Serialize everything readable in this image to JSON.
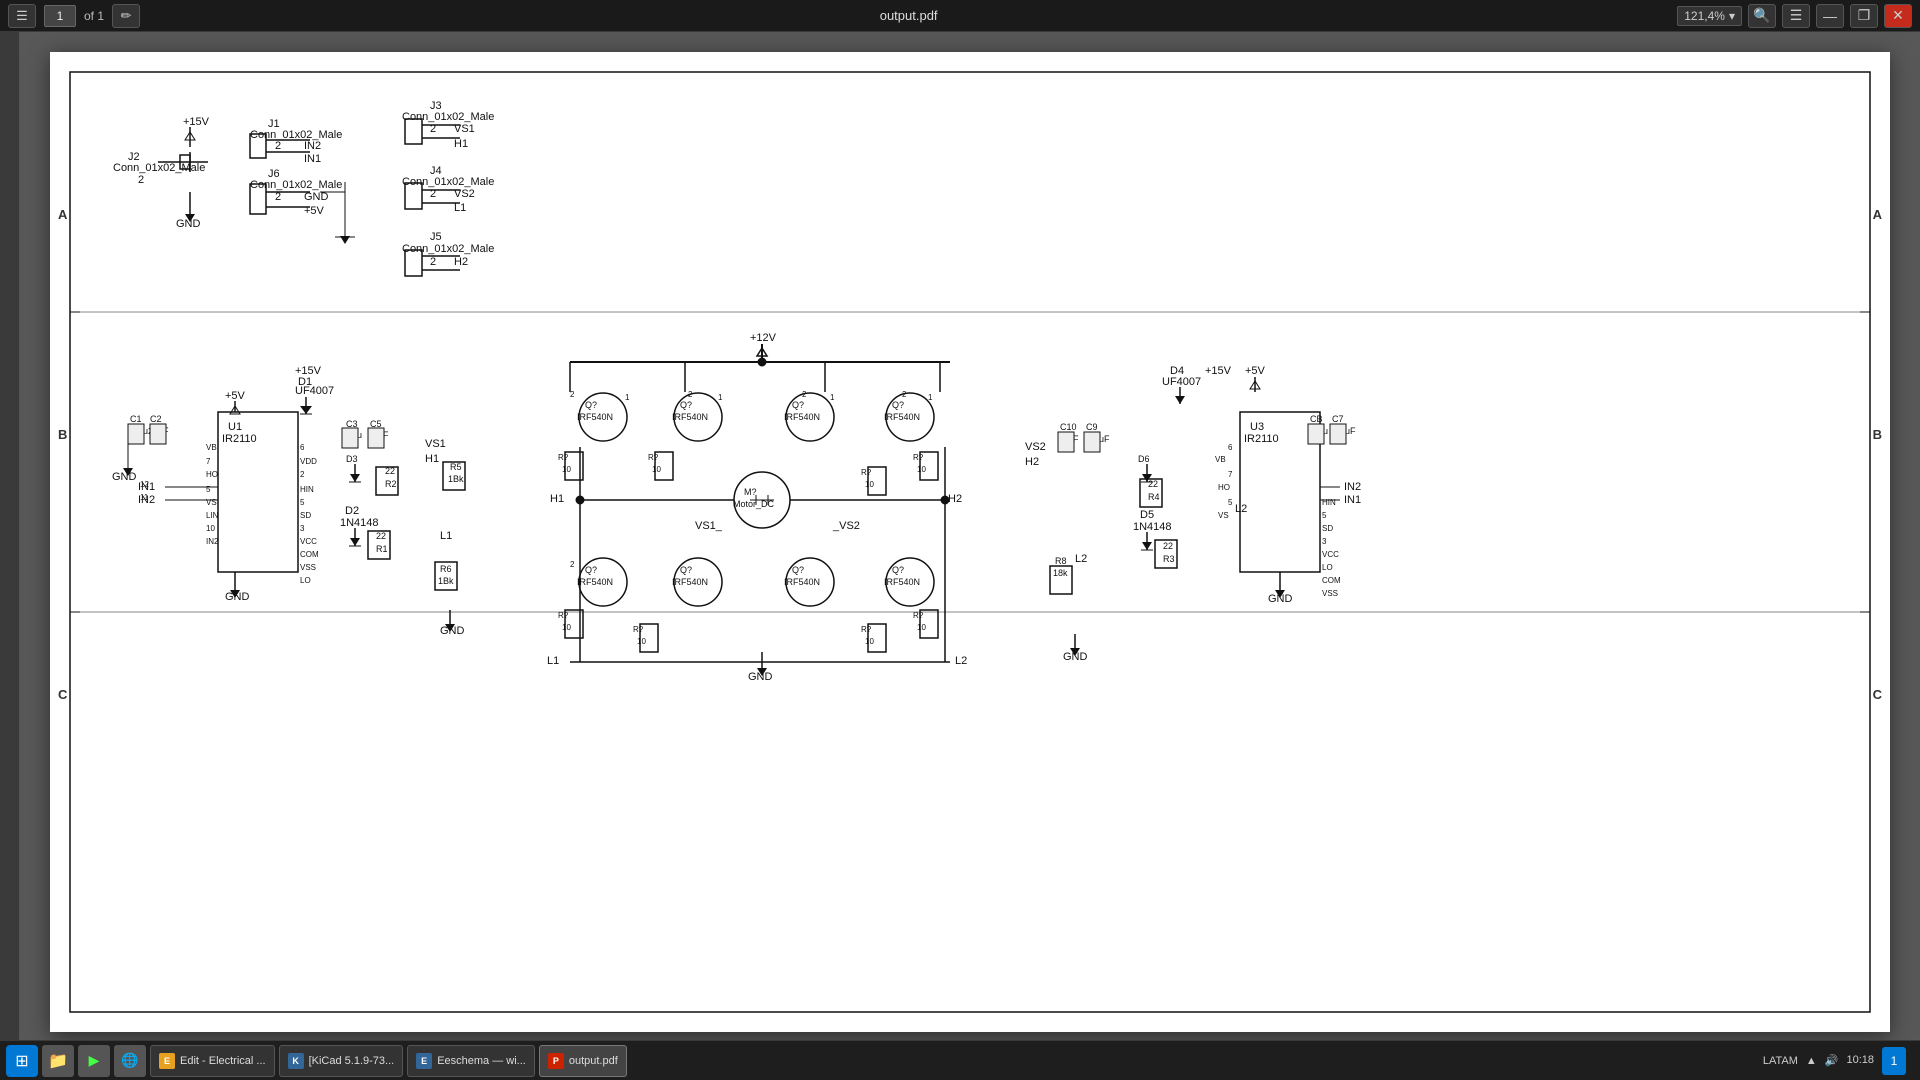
{
  "titlebar": {
    "page_number": "1",
    "page_of": "of 1",
    "filename": "output.pdf",
    "zoom": "121,4%",
    "edit_icon": "✏",
    "hamburger_icon": "☰",
    "minimize_icon": "—",
    "restore_icon": "❐",
    "close_icon": "✕",
    "search_icon": "🔍"
  },
  "border_labels": {
    "left_top": "A",
    "left_mid": "B",
    "left_bot": "C",
    "right_top": "A",
    "right_mid": "B",
    "right_bot": "C"
  },
  "taskbar": {
    "start_label": "⊞",
    "items": [
      {
        "label": "Edit - Electrical ...",
        "color": "#e8a020",
        "icon_char": "E"
      },
      {
        "label": "[KiCad 5.1.9-73...",
        "color": "#336699",
        "icon_char": "K"
      },
      {
        "label": "Eeschema — wi...",
        "color": "#336699",
        "icon_char": "E"
      },
      {
        "label": "output.pdf",
        "color": "#cc2200",
        "icon_char": "P"
      }
    ],
    "sys": {
      "lang": "LATAM",
      "signal_icon": "▲",
      "volume_icon": "🔊",
      "time": "10:18",
      "notif": "1"
    }
  }
}
